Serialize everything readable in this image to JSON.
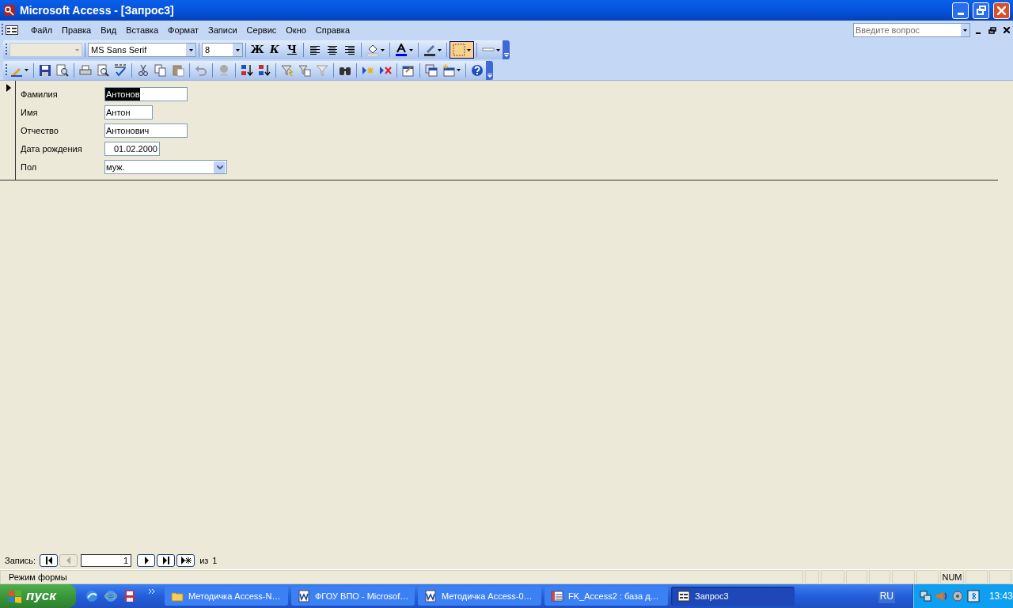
{
  "window": {
    "title": "Microsoft Access - [Запрос3]"
  },
  "menu": [
    {
      "label": "Файл"
    },
    {
      "label": "Правка"
    },
    {
      "label": "Вид"
    },
    {
      "label": "Вставка"
    },
    {
      "label": "Формат"
    },
    {
      "label": "Записи"
    },
    {
      "label": "Сервис"
    },
    {
      "label": "Окно"
    },
    {
      "label": "Справка"
    }
  ],
  "help_box": {
    "placeholder": "Введите вопрос"
  },
  "format_toolbar": {
    "font": "MS Sans Serif",
    "size": "8",
    "style_buttons": [
      "Ж",
      "К",
      "Ч"
    ]
  },
  "form": {
    "fields": [
      {
        "label": "Фамилия",
        "value": "Антонов",
        "kind": "text",
        "selected": true
      },
      {
        "label": "Имя",
        "value": "Антон",
        "kind": "text",
        "selected": false
      },
      {
        "label": "Отчество",
        "value": "Антонович",
        "kind": "text",
        "selected": false
      },
      {
        "label": "Дата рождения",
        "value": "01.02.2000",
        "kind": "date",
        "selected": false
      },
      {
        "label": "Пол",
        "value": "муж.",
        "kind": "combo",
        "selected": false
      }
    ]
  },
  "navigation": {
    "label": "Запись:",
    "current": "1",
    "of": "из",
    "total": "1"
  },
  "status_bar": {
    "text": "Режим формы",
    "indicator": "NUM"
  },
  "taskbar": {
    "start": "пуск",
    "tasks": [
      {
        "label": "Методичка Access-N…",
        "selected": false
      },
      {
        "label": "ФГОУ ВПО - Microsof…",
        "selected": false
      },
      {
        "label": "Методичка Access-0…",
        "selected": false
      },
      {
        "label": "FK_Access2 : база д…",
        "selected": false
      },
      {
        "label": "Запрос3",
        "selected": true
      }
    ],
    "language": "RU",
    "clock": "13:43"
  }
}
